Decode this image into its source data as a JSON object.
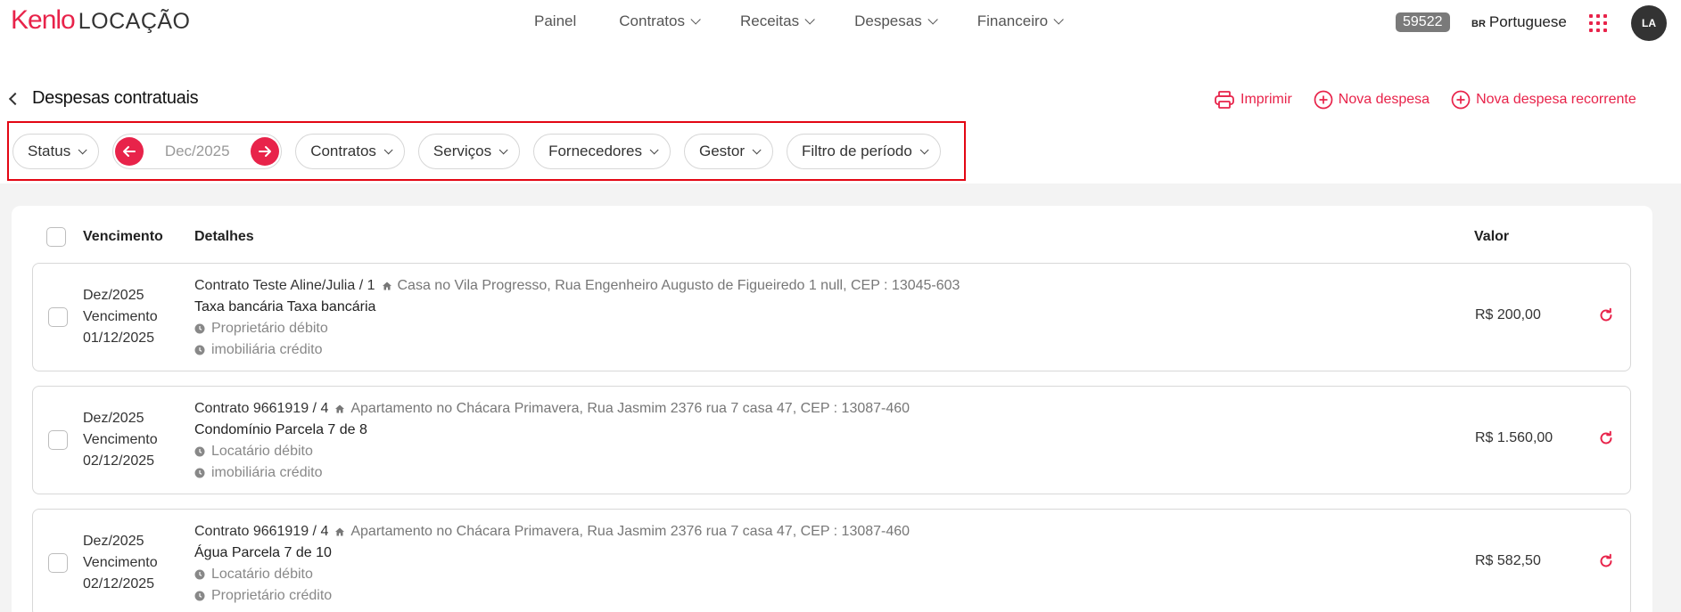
{
  "brand": {
    "name": "Kenlo",
    "product": "LOCAÇÃO",
    "accent": "#e8234a"
  },
  "nav": [
    {
      "label": "Painel",
      "dropdown": false
    },
    {
      "label": "Contratos",
      "dropdown": true
    },
    {
      "label": "Receitas",
      "dropdown": true
    },
    {
      "label": "Despesas",
      "dropdown": true
    },
    {
      "label": "Financeiro",
      "dropdown": true
    }
  ],
  "header": {
    "account_id": "59522",
    "lang_code": "BR",
    "language": "Portuguese",
    "apps_icon": "apps-grid-icon",
    "avatar_initials": "LA"
  },
  "page": {
    "title": "Despesas contratuais",
    "actions": {
      "print": "Imprimir",
      "new_expense": "Nova despesa",
      "new_recurring": "Nova despesa recorrente"
    }
  },
  "filters": {
    "status": "Status",
    "period": "Dec/2025",
    "contracts": "Contratos",
    "services": "Serviços",
    "suppliers": "Fornecedores",
    "manager": "Gestor",
    "period_filter": "Filtro de período"
  },
  "table": {
    "columns": {
      "due": "Vencimento",
      "details": "Detalhes",
      "value": "Valor"
    },
    "rows": [
      {
        "month": "Dez/2025",
        "due_label": "Vencimento",
        "due_date": "01/12/2025",
        "contract": "Contrato Teste Aline/Julia / 1",
        "address": "Casa no Vila Progresso, Rua Engenheiro Augusto de Figueiredo 1 null, CEP : 13045-603",
        "description": "Taxa bancária Taxa bancária",
        "debit": "Proprietário débito",
        "credit": "imobiliária crédito",
        "value": "R$ 200,00"
      },
      {
        "month": "Dez/2025",
        "due_label": "Vencimento",
        "due_date": "02/12/2025",
        "contract": "Contrato 9661919 / 4",
        "address": "Apartamento no Chácara Primavera, Rua Jasmim 2376 rua 7 casa 47, CEP : 13087-460",
        "description": "Condomínio Parcela 7 de 8",
        "debit": "Locatário débito",
        "credit": "imobiliária crédito",
        "value": "R$ 1.560,00"
      },
      {
        "month": "Dez/2025",
        "due_label": "Vencimento",
        "due_date": "02/12/2025",
        "contract": "Contrato 9661919 / 4",
        "address": "Apartamento no Chácara Primavera, Rua Jasmim 2376 rua 7 casa 47, CEP : 13087-460",
        "description": "Água Parcela 7 de 10",
        "debit": "Locatário débito",
        "credit": "Proprietário crédito",
        "value": "R$ 582,50"
      }
    ]
  }
}
